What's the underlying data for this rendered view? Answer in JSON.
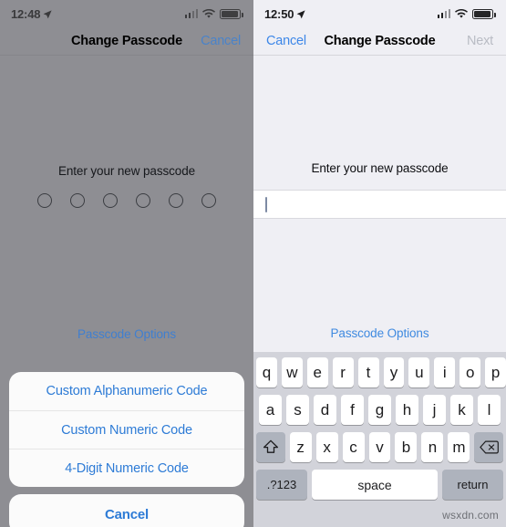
{
  "left_panel": {
    "status_bar": {
      "time": "12:48",
      "location_icon": "location-arrow-icon",
      "signal_icon": "cellular-bars-icon",
      "wifi_icon": "wifi-icon",
      "battery_icon": "battery-icon"
    },
    "nav": {
      "title": "Change Passcode",
      "right_button": "Cancel"
    },
    "prompt": "Enter your new passcode",
    "passcode_dots": 6,
    "passcode_options_link": "Passcode Options",
    "action_sheet": {
      "options": [
        "Custom Alphanumeric Code",
        "Custom Numeric Code",
        "4-Digit Numeric Code"
      ],
      "cancel": "Cancel"
    }
  },
  "right_panel": {
    "status_bar": {
      "time": "12:50",
      "location_icon": "location-arrow-icon",
      "signal_icon": "cellular-bars-icon",
      "wifi_icon": "wifi-icon",
      "battery_icon": "battery-icon"
    },
    "nav": {
      "left_button": "Cancel",
      "title": "Change Passcode",
      "right_button": "Next"
    },
    "prompt": "Enter your new passcode",
    "text_field": {
      "value": "",
      "caret": true
    },
    "passcode_options_link": "Passcode Options",
    "keyboard": {
      "row1": [
        "q",
        "w",
        "e",
        "r",
        "t",
        "y",
        "u",
        "i",
        "o",
        "p"
      ],
      "row2": [
        "a",
        "s",
        "d",
        "f",
        "g",
        "h",
        "j",
        "k",
        "l"
      ],
      "row3": [
        "z",
        "x",
        "c",
        "v",
        "b",
        "n",
        "m"
      ],
      "shift_key": "shift-icon",
      "backspace_key": "backspace-icon",
      "numbers_key": ".?123",
      "space_key": "space",
      "return_key": "return"
    }
  },
  "watermark": "wsxdn.com",
  "colors": {
    "dimmed_overlay": "#8e8e93",
    "panel_background": "#efeff4",
    "accent_blue": "#3d87e8",
    "disabled_gray": "#b9bcc4",
    "keyboard_background": "#d2d3da",
    "key_white": "#ffffff",
    "key_gray": "#aeb3bd"
  }
}
